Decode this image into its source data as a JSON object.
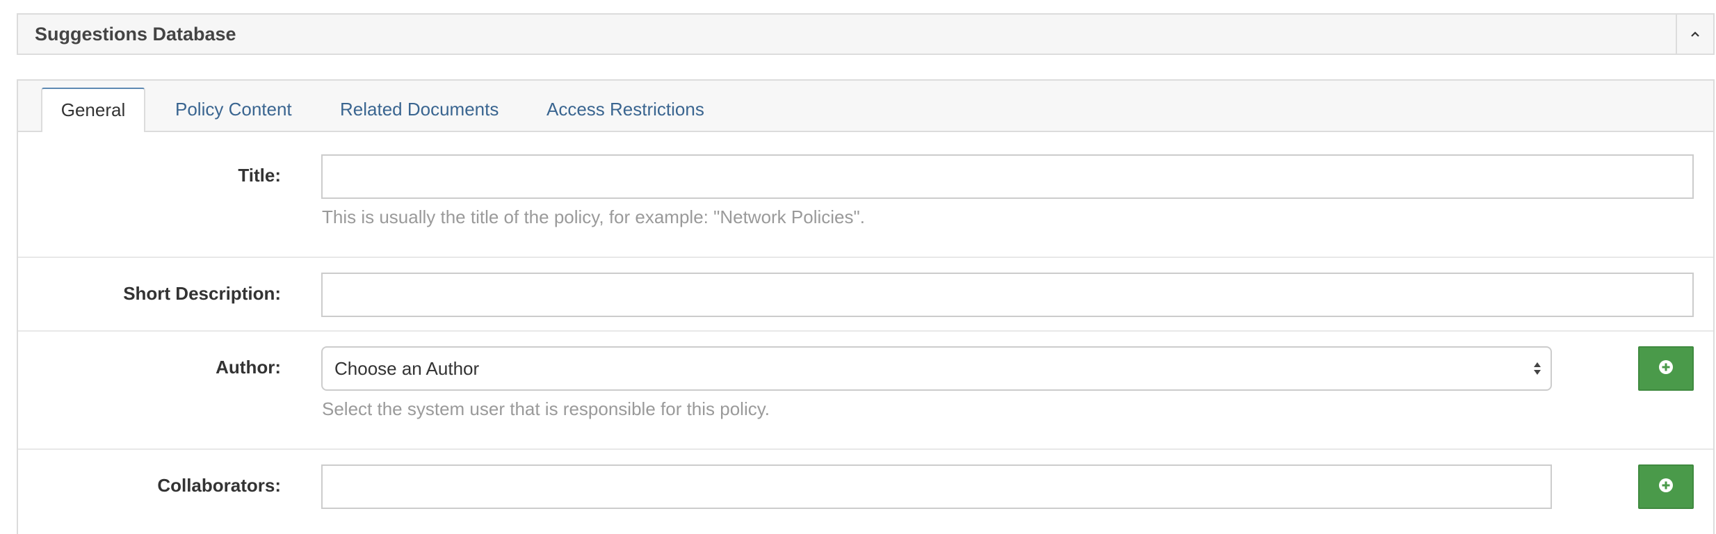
{
  "header": {
    "title": "Suggestions Database",
    "collapse_icon": "chevron-up-icon"
  },
  "tabs": [
    {
      "label": "General",
      "active": true
    },
    {
      "label": "Policy Content",
      "active": false
    },
    {
      "label": "Related Documents",
      "active": false
    },
    {
      "label": "Access Restrictions",
      "active": false
    }
  ],
  "form": {
    "title": {
      "label": "Title:",
      "value": "",
      "help": "This is usually the title of the policy, for example: \"Network Policies\"."
    },
    "short_description": {
      "label": "Short Description:",
      "value": ""
    },
    "author": {
      "label": "Author:",
      "selected": "Choose an Author",
      "help": "Select the system user that is responsible for this policy.",
      "add_icon": "plus-circle-icon"
    },
    "collaborators": {
      "label": "Collaborators:",
      "value": "",
      "add_icon": "plus-circle-icon"
    }
  },
  "colors": {
    "tab_link": "#3a6590",
    "add_button": "#4a9a4a",
    "help_text": "#9a9a9a",
    "border": "#dcdcdc"
  }
}
